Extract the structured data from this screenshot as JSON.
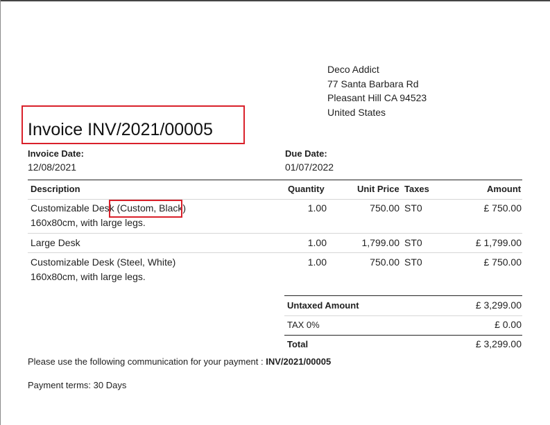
{
  "company_address": {
    "name": "Deco Addict",
    "street": "77 Santa Barbara Rd",
    "city_line": "Pleasant Hill CA 94523",
    "country": "United States"
  },
  "invoice": {
    "title": "Invoice INV/2021/00005",
    "date_label": "Invoice Date:",
    "date_value": "12/08/2021",
    "due_label": "Due Date:",
    "due_value": "01/07/2022"
  },
  "table": {
    "headers": {
      "description": "Description",
      "quantity": "Quantity",
      "unit_price": "Unit Price",
      "taxes": "Taxes",
      "amount": "Amount"
    },
    "rows": [
      {
        "description_main": "Customizable Desk",
        "description_variant": "(Custom, Black)",
        "description_detail": "160x80cm, with large legs.",
        "quantity": "1.00",
        "unit_price": "750.00",
        "taxes": "ST0",
        "amount": "£ 750.00"
      },
      {
        "description_main": "Large Desk",
        "quantity": "1.00",
        "unit_price": "1,799.00",
        "taxes": "ST0",
        "amount": "£ 1,799.00"
      },
      {
        "description_main": "Customizable Desk (Steel, White)",
        "description_detail": "160x80cm, with large legs.",
        "quantity": "1.00",
        "unit_price": "750.00",
        "taxes": "ST0",
        "amount": "£ 750.00"
      }
    ]
  },
  "totals": {
    "untaxed_label": "Untaxed Amount",
    "untaxed_value": "£ 3,299.00",
    "tax_label": "TAX 0%",
    "tax_value": "£ 0.00",
    "total_label": "Total",
    "total_value": "£ 3,299.00"
  },
  "footer": {
    "communication_text": "Please use the following communication for your payment :",
    "communication_ref": "INV/2021/00005",
    "payment_terms": "Payment terms: 30 Days"
  },
  "colors": {
    "highlight": "#d9202a"
  }
}
